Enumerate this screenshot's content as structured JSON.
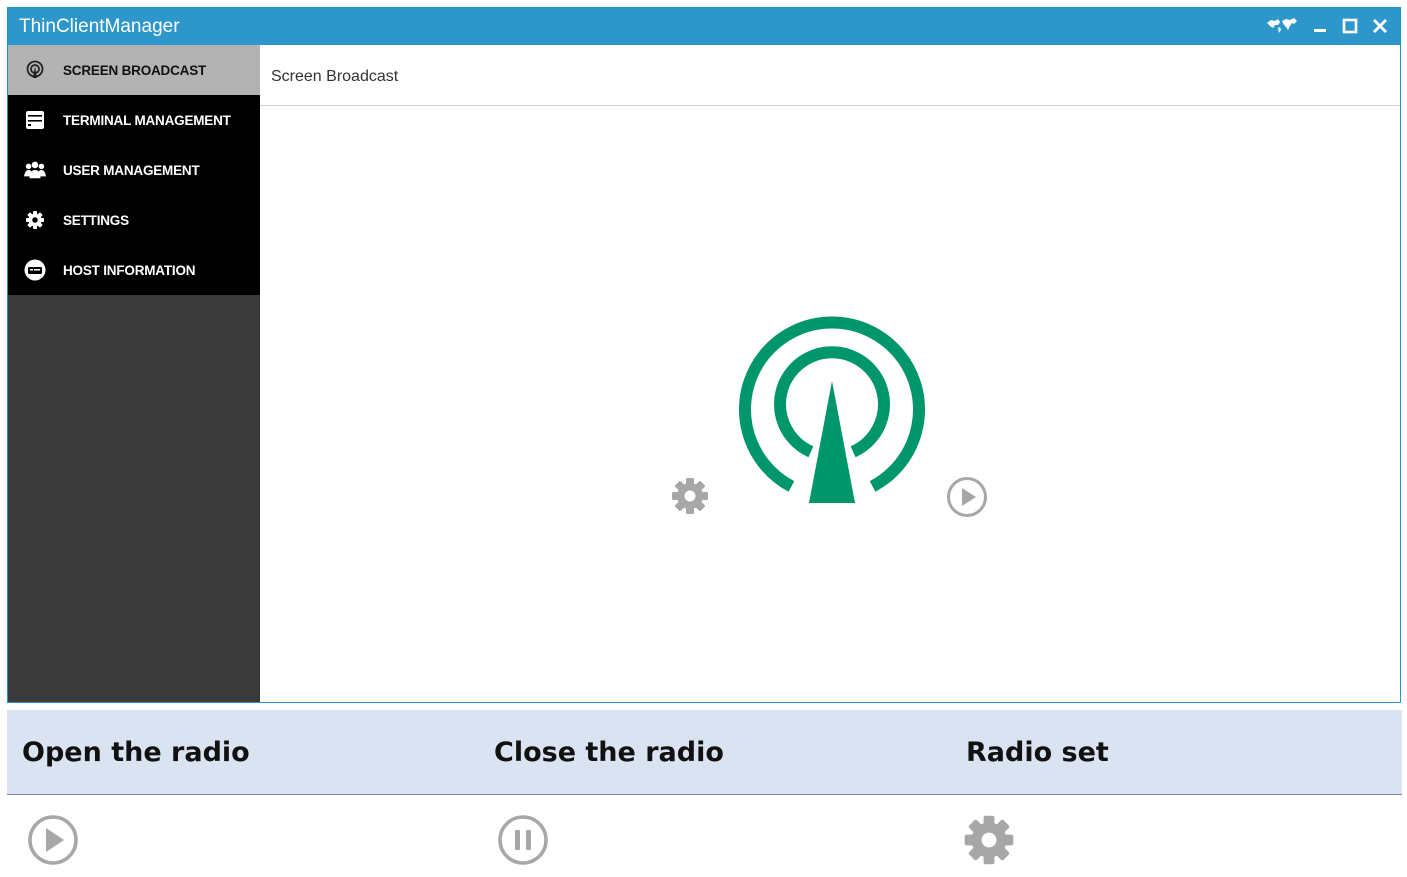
{
  "window": {
    "title": "ThinClientManager",
    "controls": {
      "network_icon": "network-status-icon",
      "minimize": "minimize-icon",
      "maximize": "maximize-icon",
      "close": "close-icon"
    }
  },
  "sidebar": {
    "items": [
      {
        "label": "SCREEN BROADCAST",
        "icon": "broadcast-icon",
        "active": true
      },
      {
        "label": "TERMINAL MANAGEMENT",
        "icon": "server-icon",
        "active": false
      },
      {
        "label": "USER MANAGEMENT",
        "icon": "users-icon",
        "active": false
      },
      {
        "label": "SETTINGS",
        "icon": "gear-icon",
        "active": false
      },
      {
        "label": "HOST INFORMATION",
        "icon": "host-info-icon",
        "active": false
      }
    ]
  },
  "main": {
    "title": "Screen Broadcast",
    "center_icon": "broadcast-antenna-icon",
    "buttons": {
      "settings": "gear-icon",
      "play": "play-icon"
    }
  },
  "legend_table": {
    "columns": [
      "Open the radio",
      "Close the radio",
      "Radio set"
    ],
    "icons": [
      "play-icon",
      "pause-icon",
      "gear-icon"
    ]
  },
  "colors": {
    "titlebar": "#2d97cc",
    "sidebar_active": "#b3b3b3",
    "sidebar_item": "#000000",
    "sidebar_bg": "#3a3a3a",
    "accent_green": "#00966b",
    "icon_gray": "#a7a7a7",
    "table_header": "#d9e3f1"
  }
}
